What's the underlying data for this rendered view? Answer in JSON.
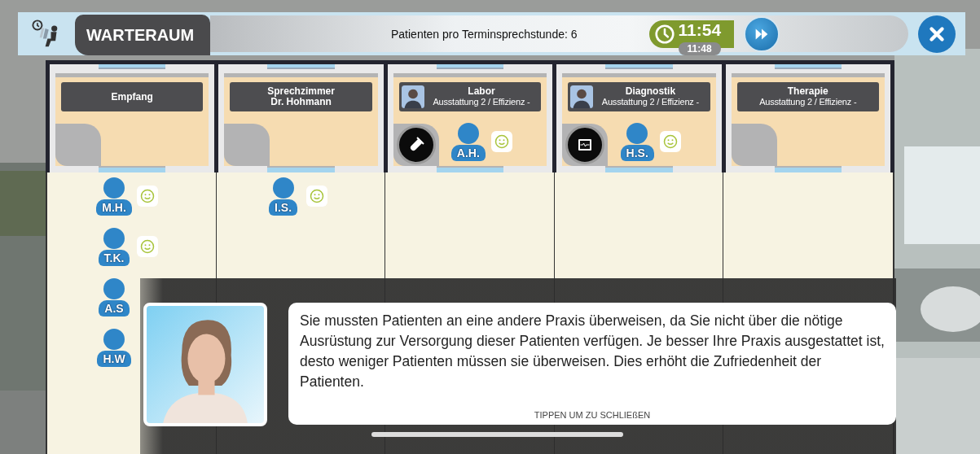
{
  "header": {
    "title": "WARTERAUM",
    "info": "Patienten pro Terminsprechstunde: 6",
    "clock": {
      "time": "11:54",
      "previous_time": "11:48"
    }
  },
  "rooms": [
    {
      "name": "Empfang"
    },
    {
      "name": "Sprechzimmer\nDr. Hohmann"
    },
    {
      "name": "Labor",
      "subtitle": "Ausstattung 2 / Effizienz -",
      "staff": true,
      "equipment": {
        "kind": "test_tube"
      },
      "patient": {
        "initials": "A.H.",
        "satisfied": true
      }
    },
    {
      "name": "Diagnostik",
      "subtitle": "Ausstattung 2 / Effizienz -",
      "staff": true,
      "equipment": {
        "kind": "monitor"
      },
      "patient": {
        "initials": "H.S.",
        "satisfied": true
      }
    },
    {
      "name": "Therapie",
      "subtitle": "Ausstattung 2 / Effizienz -"
    }
  ],
  "waiting_area": {
    "columns": [
      {
        "patients": [
          {
            "initials": "M.H.",
            "satisfied": true
          },
          {
            "initials": "T.K.",
            "satisfied": true
          },
          {
            "initials": "A.S"
          },
          {
            "initials": "H.W"
          }
        ]
      },
      {
        "patients": [
          {
            "initials": "I.S.",
            "satisfied": true
          }
        ]
      },
      {},
      {},
      {}
    ]
  },
  "dialog": {
    "text": "Sie mussten Patienten an eine andere Praxis überweisen, da Sie nicht über die nötige Ausrüstung zur Versorgung dieser Patienten verfügen. Je besser Ihre Praxis ausgestattet ist, desto weniger Patienten müssen sie überweisen. Dies erhöht die Zufriedenheit der Patienten.",
    "hint": "TIPPEN UM ZU SCHLIEßEN"
  }
}
